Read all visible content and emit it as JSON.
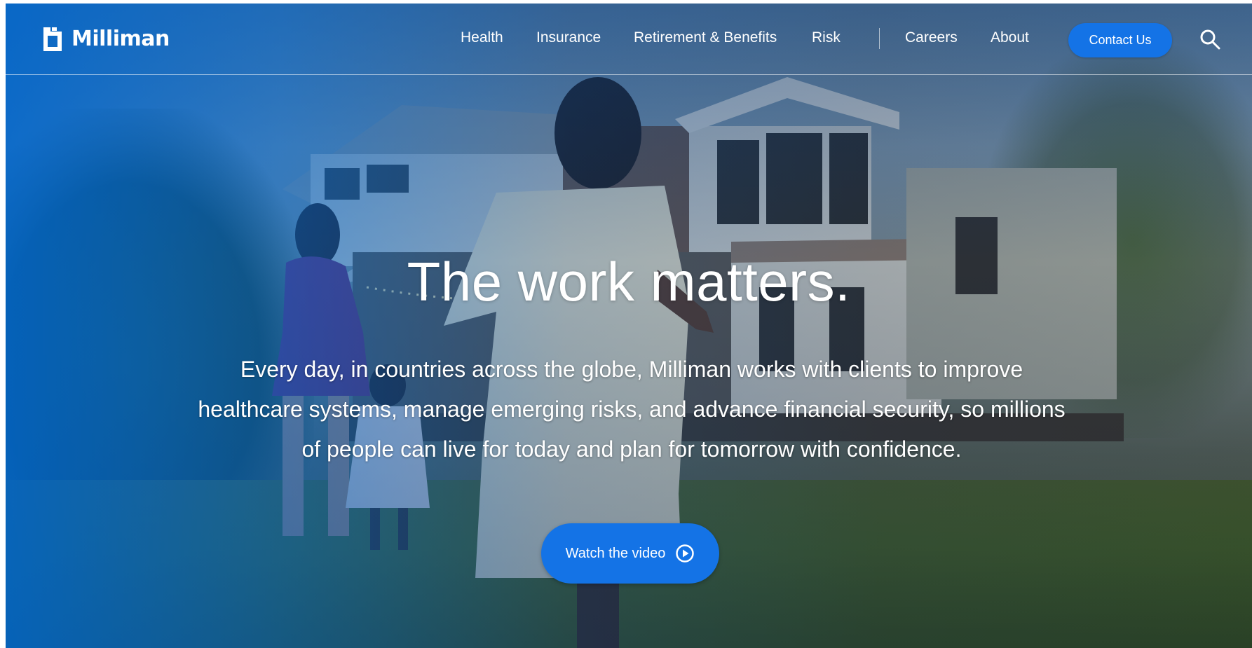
{
  "brand": {
    "name": "Milliman",
    "accent_color": "#1473e6",
    "overlay_color": "#0066cc"
  },
  "nav": {
    "items": [
      {
        "label": "Health"
      },
      {
        "label": "Insurance"
      },
      {
        "label": "Retirement & Benefits"
      },
      {
        "label": "Risk"
      },
      {
        "label": "Careers"
      },
      {
        "label": "About"
      }
    ],
    "contact_label": "Contact Us",
    "search_icon": "search-icon"
  },
  "hero": {
    "title": "The work matters.",
    "subtitle": "Every day, in countries across the globe, Milliman works with clients to improve healthcare systems, manage emerging risks, and advance financial security, so millions of people can live for today and plan for tomorrow with confidence.",
    "cta_label": "Watch the video",
    "cta_icon": "play-circle-icon"
  }
}
